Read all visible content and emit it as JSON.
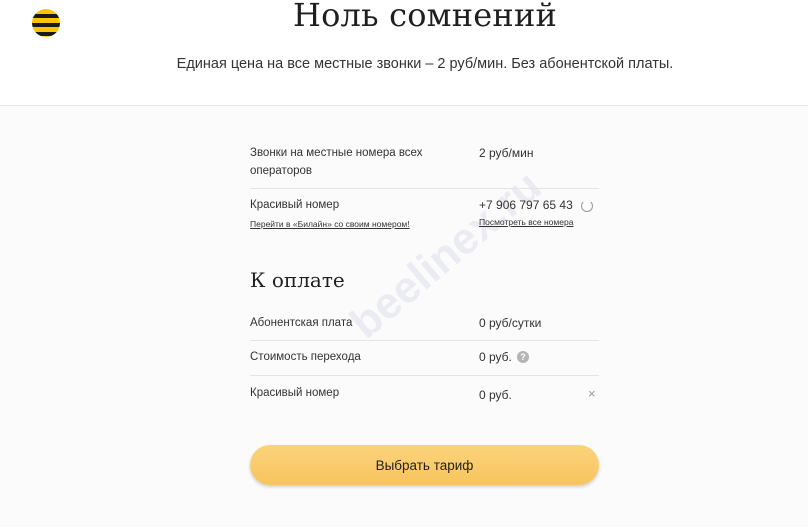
{
  "header": {
    "title": "Ноль сомнений",
    "subtitle": "Единая цена на все местные звонки – 2 руб/мин. Без абонентской платы."
  },
  "details": {
    "calls_label_line1": "Звонки на местные номера всех",
    "calls_label_line2": "операторов",
    "calls_value": "2 руб/мин",
    "beautiful_number_label": "Красивый номер",
    "transfer_link": "Перейти в «Билайн» со своим номером!",
    "phone_number": "+7 906 797 65 43",
    "view_all_link": "Посмотреть все номера"
  },
  "payment": {
    "title": "К оплате",
    "rows": [
      {
        "label": "Абонентская плата",
        "value": "0 руб/сутки"
      },
      {
        "label": "Стоимость перехода",
        "value": "0 руб."
      },
      {
        "label": "Красивый номер",
        "value": "0 руб."
      }
    ]
  },
  "help_glyph": "?",
  "close_glyph": "×",
  "cta_label": "Выбрать тариф",
  "watermark": "beelinex.ru",
  "colors": {
    "brand_yellow": "#ffc400",
    "button": "#f7c45f"
  }
}
